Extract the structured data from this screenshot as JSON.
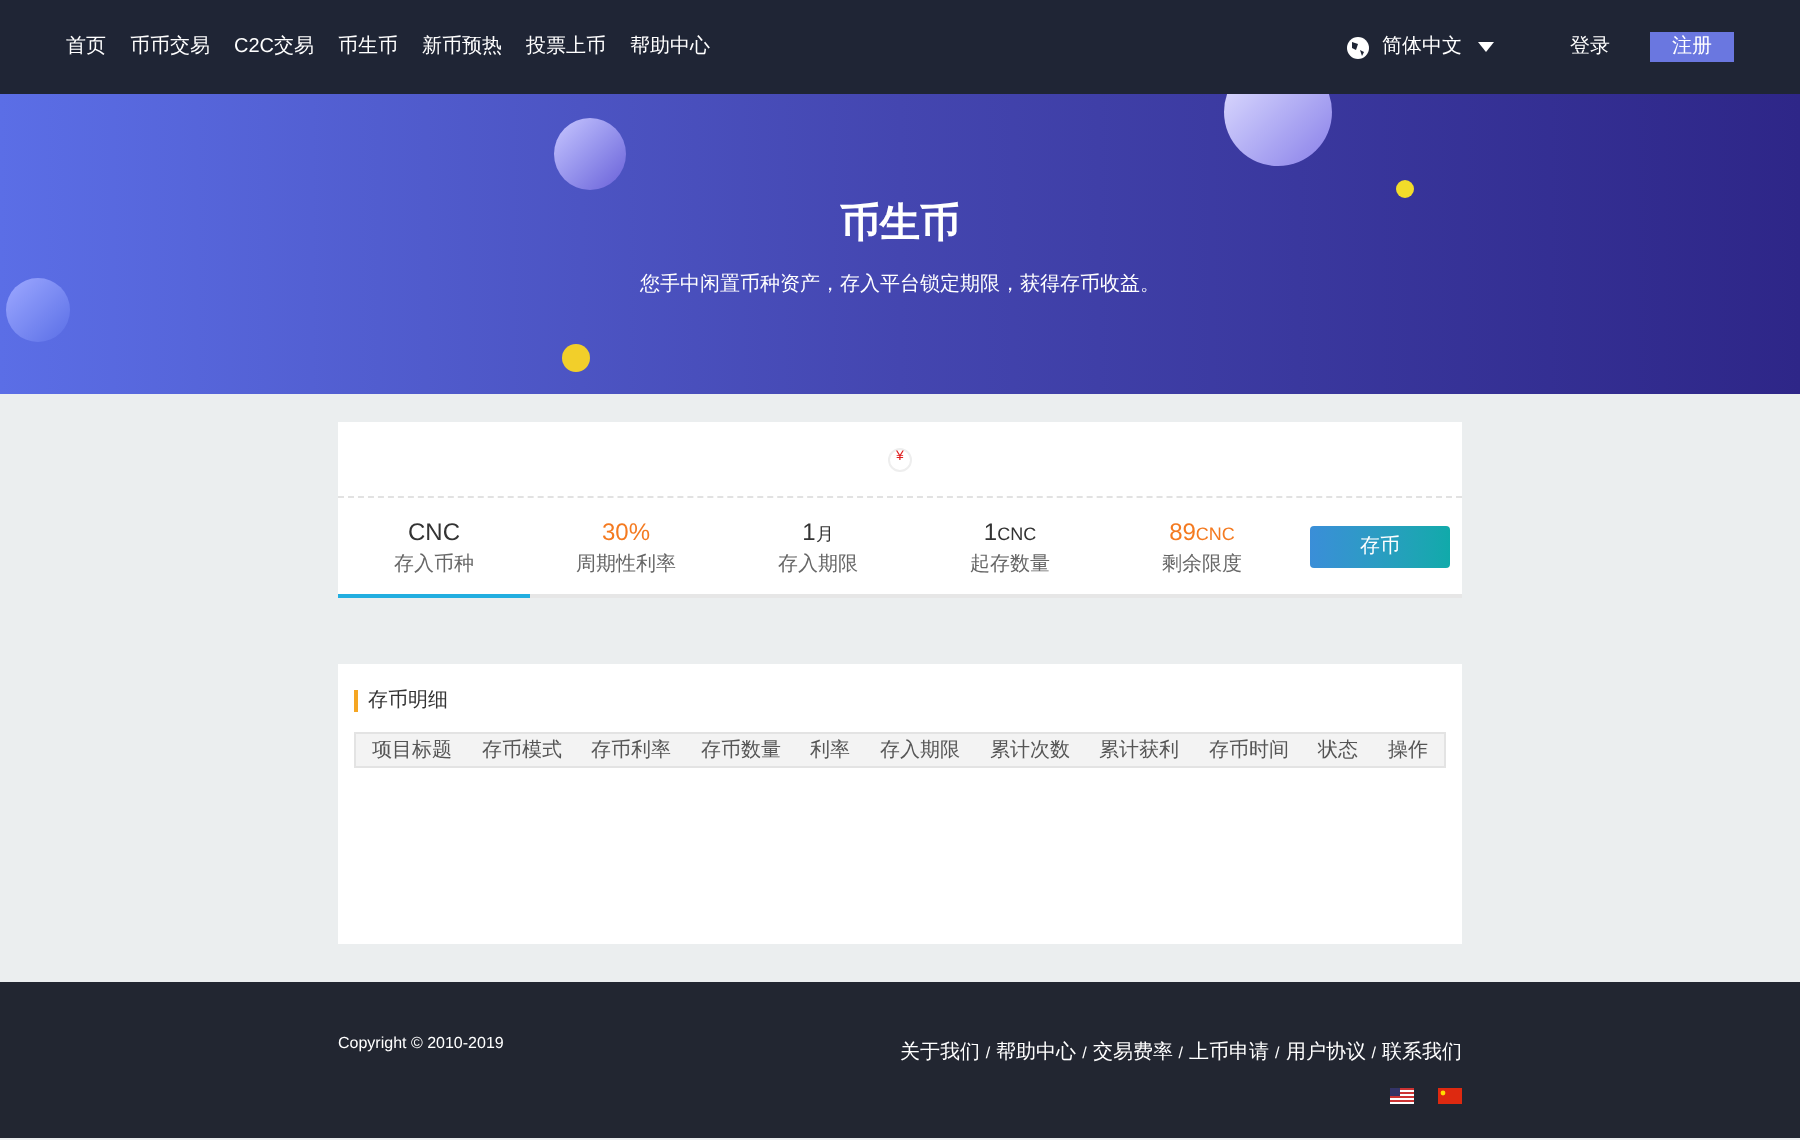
{
  "nav": {
    "items": [
      {
        "label": "首页"
      },
      {
        "label": "币币交易"
      },
      {
        "label": "C2C交易"
      },
      {
        "label": "币生币"
      },
      {
        "label": "新币预热"
      },
      {
        "label": "投票上币"
      },
      {
        "label": "帮助中心"
      }
    ],
    "language": "简体中文",
    "login": "登录",
    "register": "注册"
  },
  "hero": {
    "title": "币生币",
    "subtitle": "您手中闲置币种资产，存入平台锁定期限，获得存币收益。"
  },
  "product": {
    "icon": "¥",
    "stats": [
      {
        "value": "CNC",
        "label": "存入币种",
        "highlight": false,
        "selected": true
      },
      {
        "value": "30%",
        "label": "周期性利率",
        "highlight": true,
        "selected": false
      },
      {
        "value": "1",
        "unit": "月",
        "label": "存入期限",
        "highlight": false,
        "selected": false
      },
      {
        "value": "1",
        "unit": "CNC",
        "label": "起存数量",
        "highlight": false,
        "selected": false
      },
      {
        "value": "89",
        "unit": "CNC",
        "label": "剩余限度",
        "highlight": true,
        "selected": false
      }
    ],
    "button": "存币"
  },
  "records": {
    "title": "存币明细",
    "columns": [
      "项目标题",
      "存币模式",
      "存币利率",
      "存币数量",
      "利率",
      "存入期限",
      "累计次数",
      "累计获利",
      "存币时间",
      "状态",
      "操作"
    ]
  },
  "footer": {
    "copyright": "Copyright © 2010-2019",
    "links": [
      {
        "label": "关于我们"
      },
      {
        "separator": "/",
        "label": "帮助中心"
      },
      {
        "separator": "/",
        "label": "交易费率"
      },
      {
        "separator": "/",
        "label": "上币申请"
      },
      {
        "separator": "/",
        "label": "用户协议"
      },
      {
        "separator": "/",
        "label": "联系我们"
      }
    ]
  }
}
